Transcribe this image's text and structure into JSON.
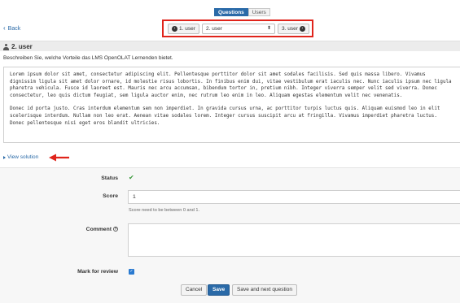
{
  "header": {
    "tabs": [
      {
        "label": "Questions",
        "active": true
      },
      {
        "label": "Users",
        "active": false
      }
    ]
  },
  "nav": {
    "back_label": "Back",
    "prev_label": "1. user",
    "current_select": "2. user",
    "next_label": "3. user"
  },
  "question": {
    "title": "2. user",
    "description": "Beschreiben Sie, welche Vorteile das LMS OpenOLAT Lernenden bietet.",
    "answer_paragraphs": [
      "Lorem ipsum dolor sit amet, consectetur adipiscing elit. Pellentesque porttitor dolor sit amet sodales facilisis. Sed quis massa libero. Vivamus dignissim ligula sit amet dolor ornare, id molestie risus lobortis. In finibus enim dui, vitae vestibulum erat iaculis nec. Nunc iaculis ipsum nec ligula pharetra vehicula. Fusce id laoreet est. Mauris nec arcu accumsan, bibendum tortor in, pretium nibh. Integer viverra semper velit sed viverra. Donec consectetur, leo quis dictum feugiat, sem ligula auctor enim, nec rutrum leo enim in leo. Aliquam egestas elementum velit nec venenatis.",
      "Donec id porta justo. Cras interdum elementum sem non imperdiet. In gravida cursus urna, ac porttitor turpis luctus quis. Aliquam euismod leo in elit scelerisque interdum. Nullam non leo erat. Aenean vitae sodales lorem. Integer cursus suscipit arcu at fringilla. Vivamus imperdiet pharetra luctus. Donec pellentesque nisi eget eros blandit ultricies."
    ],
    "view_solution_label": "View solution"
  },
  "form": {
    "status_label": "Status",
    "score_label": "Score",
    "score_value": "1",
    "score_hint": "Score need to be between 0 and 1.",
    "comment_label": "Comment",
    "mark_label": "Mark for review",
    "mark_checked": true
  },
  "buttons": {
    "cancel": "Cancel",
    "save": "Save",
    "save_next": "Save and next question"
  },
  "colors": {
    "accent": "#2a6aa8",
    "highlight": "#e0241b",
    "status_ok": "#3c9a3c"
  }
}
